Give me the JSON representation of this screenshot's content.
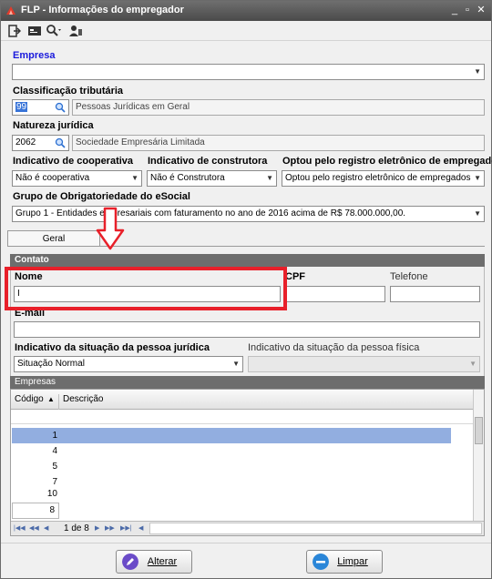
{
  "window": {
    "title": "FLP - Informações do empregador"
  },
  "empresa": {
    "label": "Empresa",
    "value": ""
  },
  "classificacao": {
    "label": "Classificação tributária",
    "code": "99",
    "description": "Pessoas Jurídicas em Geral"
  },
  "natureza": {
    "label": "Natureza jurídica",
    "code": "2062",
    "description": "Sociedade Empresária Limitada"
  },
  "cooperativa": {
    "label": "Indicativo de cooperativa",
    "value": "Não é cooperativa"
  },
  "construtora": {
    "label": "Indicativo de construtora",
    "value": "Não é Construtora"
  },
  "registro": {
    "label": "Optou pelo registro eletrônico de empregados",
    "value": "Optou pelo registro eletrônico de empregados"
  },
  "grupo": {
    "label": "Grupo de Obrigatoriedade do eSocial",
    "value": "Grupo 1 - Entidades empresariais com faturamento no ano de 2016 acima de R$ 78.000.000,00."
  },
  "tabs": [
    {
      "label": "Geral"
    }
  ],
  "contato": {
    "header": "Contato",
    "nome_label": "Nome",
    "nome_value": "I",
    "cpf_label": "CPF",
    "telefone_label": "Telefone",
    "email_label": "E-mail",
    "situacao_pj_label": "Indicativo da situação da pessoa jurídica",
    "situacao_pj_value": "Situação Normal",
    "situacao_pf_label": "Indicativo da situação da pessoa física",
    "situacao_pf_value": ""
  },
  "empresas": {
    "header": "Empresas",
    "columns": [
      "Código",
      "Descrição"
    ],
    "rows": [
      "1",
      "4",
      "5",
      "7",
      "10"
    ],
    "selected_index": 0,
    "total": "8",
    "pager": "1 de 8"
  },
  "buttons": {
    "alterar": "Alterar",
    "limpar": "Limpar"
  },
  "colors": {
    "highlight": "#e8202a",
    "accent": "#1a1adc",
    "selected_row": "#92aee0"
  },
  "icons": [
    "app-icon",
    "exit-icon",
    "card-icon",
    "search-icon",
    "user-icon",
    "magnifier-icon",
    "chevron-down-icon",
    "sort-up-icon",
    "edit-icon",
    "minus-icon"
  ]
}
